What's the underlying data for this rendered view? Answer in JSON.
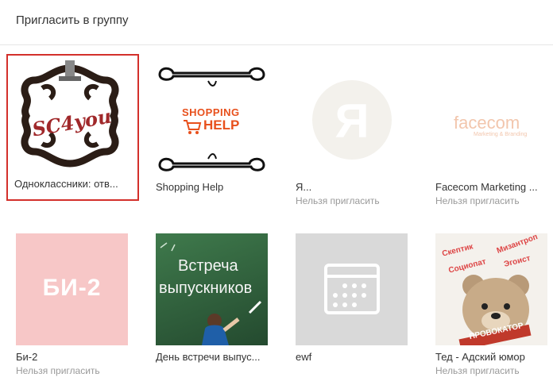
{
  "header": {
    "title": "Пригласить в группу"
  },
  "groups": [
    {
      "name": "Одноклассники: отв...",
      "logo_text": "SC4you",
      "selected": true
    },
    {
      "name": "Shopping Help",
      "logo_text_1": "SHOPPING",
      "logo_text_2": "HELP"
    },
    {
      "name": "Я...",
      "status": "Нельзя пригласить",
      "logo_text": "Я"
    },
    {
      "name": "Facecom Marketing ...",
      "status": "Нельзя пригласить",
      "logo_text": "facecom",
      "logo_sub": "Marketing & Branding"
    },
    {
      "name": "Би-2",
      "status": "Нельзя пригласить",
      "logo_text": "БИ-2"
    },
    {
      "name": "День встречи выпус...",
      "logo_text_1": "Встреча",
      "logo_text_2": "выпускников"
    },
    {
      "name": "ewf",
      "icon": "calendar-icon"
    },
    {
      "name": "Тед - Адский юмор",
      "status": "Нельзя пригласить",
      "logo_words": [
        "Скептик",
        "Социопат",
        "Эгоист",
        "Мизантроп"
      ],
      "logo_banner": "ПРОВОКАТОР"
    }
  ],
  "colors": {
    "selected_border": "#d3302b",
    "shop_orange": "#e8501c",
    "muted": "#999999"
  }
}
